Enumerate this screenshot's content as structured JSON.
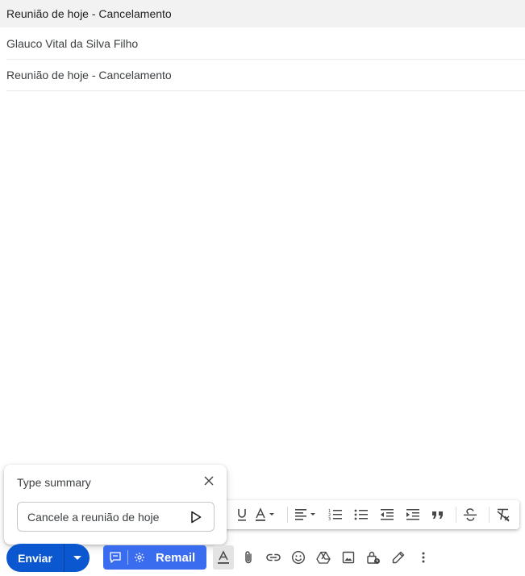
{
  "compose": {
    "header_title": "Reunião de hoje - Cancelamento",
    "to": "Glauco Vital da Silva Filho",
    "subject": "Reunião de hoje - Cancelamento",
    "body": ""
  },
  "summary_popup": {
    "title": "Type summary",
    "input_value": "Cancele a reunião de hoje"
  },
  "actions": {
    "send_label": "Enviar",
    "remail_label": "Remail"
  },
  "colors": {
    "send_blue": "#0b57d0",
    "remail_blue": "#3a6cf0",
    "header_bg": "#f2f2f2"
  },
  "format_toolbar_icons": [
    "underline-icon",
    "text-color-icon",
    "align-icon",
    "numbered-list-icon",
    "bulleted-list-icon",
    "indent-less-icon",
    "indent-more-icon",
    "quote-icon",
    "strikethrough-icon",
    "remove-formatting-icon"
  ],
  "action_icons": [
    "formatting-options-icon",
    "attach-icon",
    "link-icon",
    "emoji-icon",
    "drive-icon",
    "photo-icon",
    "confidential-mode-icon",
    "signature-icon",
    "more-options-icon"
  ]
}
